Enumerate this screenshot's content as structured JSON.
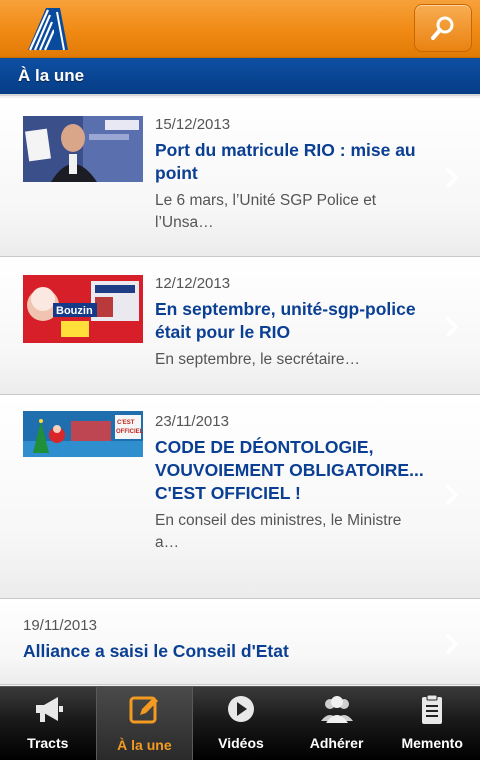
{
  "header": {
    "logo_icon": "alliance-logo-icon",
    "search_icon": "search-icon",
    "accent": "#f08a14"
  },
  "section": {
    "title": "À la une",
    "color": "#0a4a9c"
  },
  "news": [
    {
      "date": "15/12/2013",
      "title": "Port du matricule RIO : mise au point",
      "excerpt": "Le 6 mars, l’Unité SGP Police et l’Unsa…",
      "has_thumbnail": true
    },
    {
      "date": "12/12/2013",
      "title": "En septembre, unité-sgp-police était pour le RIO",
      "excerpt": "En septembre, le secrétaire…",
      "has_thumbnail": true
    },
    {
      "date": "23/11/2013",
      "title": "CODE DE DÉONTOLOGIE, VOUVOIEMENT OBLIGATOIRE... C'EST OFFICIEL !",
      "excerpt": "En conseil des ministres, le Ministre a…",
      "has_thumbnail": true
    },
    {
      "date": "19/11/2013",
      "title": "Alliance a saisi le Conseil d'Etat",
      "excerpt": "",
      "has_thumbnail": false
    }
  ],
  "tabs": [
    {
      "label": "Tracts",
      "icon": "megaphone-icon",
      "active": false
    },
    {
      "label": "À la une",
      "icon": "edit-icon",
      "active": true
    },
    {
      "label": "Vidéos",
      "icon": "play-icon",
      "active": false
    },
    {
      "label": "Adhérer",
      "icon": "users-icon",
      "active": false
    },
    {
      "label": "Memento",
      "icon": "clipboard-icon",
      "active": false
    }
  ]
}
